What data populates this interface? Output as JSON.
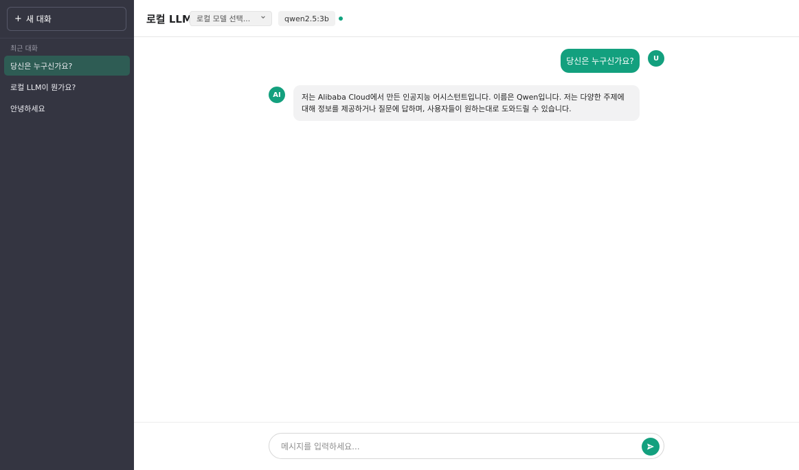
{
  "sidebar": {
    "new_chat_label": "새 대화",
    "recent_label": "최근 대화",
    "conversations": [
      {
        "title": "당신은 누구신가요?",
        "active": true
      },
      {
        "title": "로컬 LLM이 뭔가요?",
        "active": false
      },
      {
        "title": "안녕하세요",
        "active": false
      }
    ]
  },
  "header": {
    "title": "로컬 LLM",
    "model_select_placeholder": "로컬 모델 선택...",
    "model_badge": "qwen2.5:3b",
    "status_color": "#10a37f"
  },
  "messages": [
    {
      "role": "user",
      "avatar": "U",
      "text": "당신은 누구신가요?"
    },
    {
      "role": "assistant",
      "avatar": "AI",
      "text": "저는 Alibaba Cloud에서 만든 인공지능 어시스턴트입니다. 이름은 Qwen입니다. 저는 다양한 주제에 대해 정보를 제공하거나 질문에 답하며, 사용자들이 원하는대로 도와드릴 수 있습니다."
    }
  ],
  "composer": {
    "placeholder": "메시지를 입력하세요...",
    "value": ""
  },
  "colors": {
    "accent": "#13a07e",
    "sidebar_bg": "#343541",
    "active_item_bg": "#2e5c54"
  },
  "icons": {
    "new_chat": "plus-icon",
    "select_chevron": "chevron-down-icon",
    "send": "send-icon"
  }
}
